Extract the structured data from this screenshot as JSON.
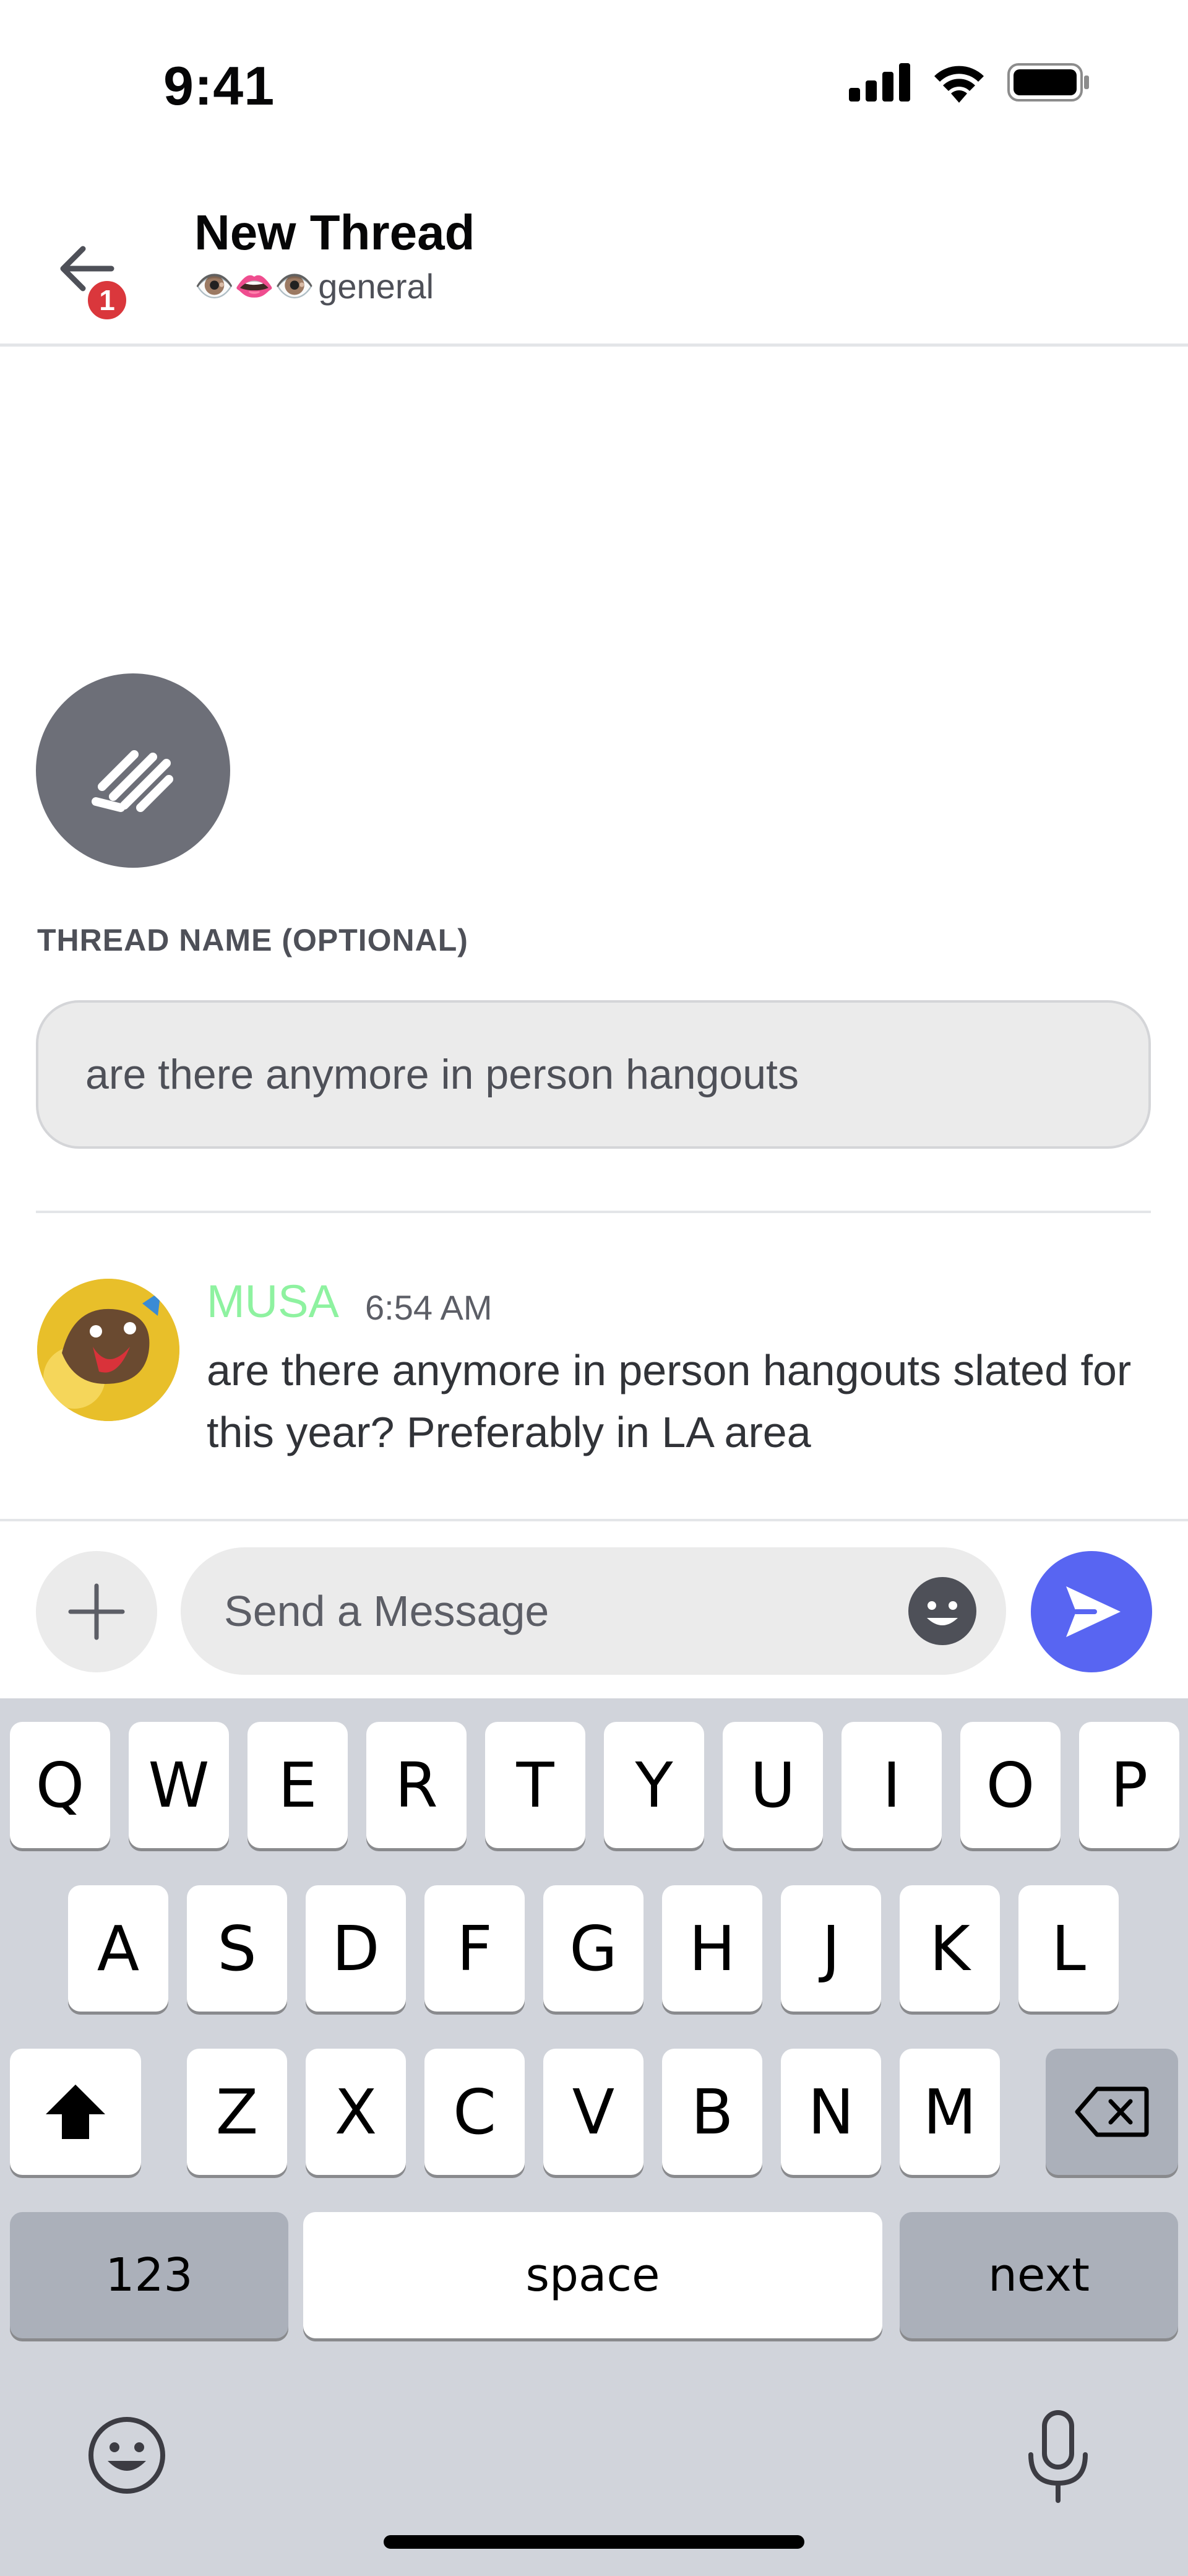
{
  "status_bar": {
    "time": "9:41",
    "icons": [
      "cellular-signal-icon",
      "wifi-icon",
      "battery-icon"
    ]
  },
  "header": {
    "back_badge": "1",
    "title": "New Thread",
    "channel_emoji": "👁️👄👁️",
    "channel_name": "general"
  },
  "thread_form": {
    "section_label": "THREAD NAME (OPTIONAL)",
    "thread_name_value": "are there anymore in person hangouts"
  },
  "message": {
    "author": "MUSA",
    "author_color": "#8ef2a0",
    "timestamp": "6:54 AM",
    "text": "are there anymore in person hangouts slated for this year? Preferably in LA area"
  },
  "composer": {
    "placeholder": "Send a Message",
    "send_color": "#5865f2"
  },
  "keyboard": {
    "row1": [
      "Q",
      "W",
      "E",
      "R",
      "T",
      "Y",
      "U",
      "I",
      "O",
      "P"
    ],
    "row2": [
      "A",
      "S",
      "D",
      "F",
      "G",
      "H",
      "J",
      "K",
      "L"
    ],
    "row3": [
      "Z",
      "X",
      "C",
      "V",
      "B",
      "N",
      "M"
    ],
    "numbers_key": "123",
    "space_key": "space",
    "return_key": "next"
  }
}
